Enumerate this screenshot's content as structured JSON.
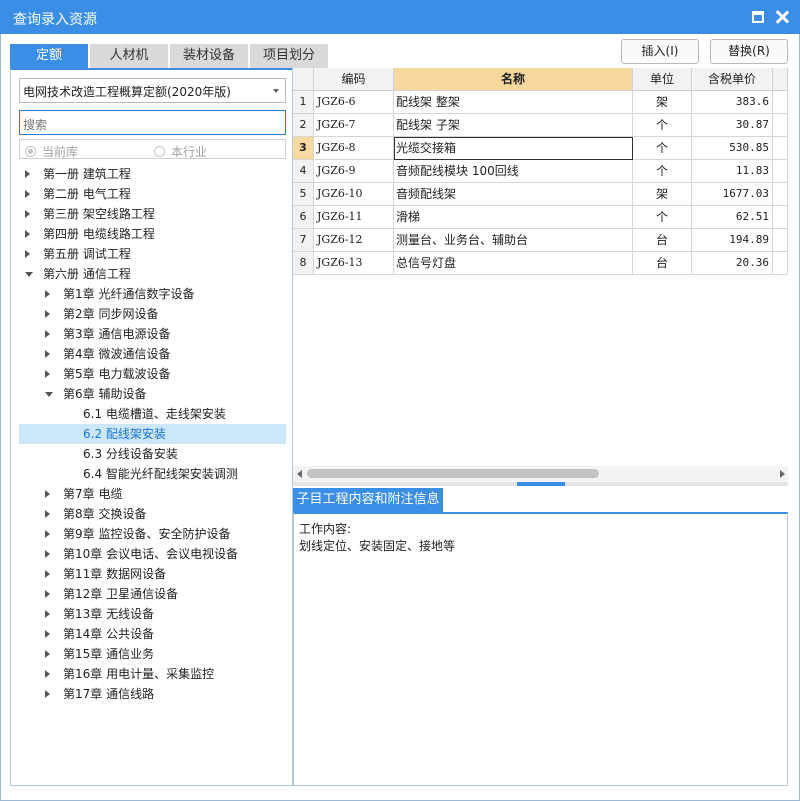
{
  "window": {
    "title": "查询录入资源"
  },
  "tabs": [
    "定额",
    "人材机",
    "装材设备",
    "项目划分"
  ],
  "header_buttons": {
    "insert": "插入(I)",
    "replace": "替换(R)"
  },
  "left": {
    "quota_library": "电网技术改造工程概算定额(2020年版)",
    "search_placeholder": "搜索",
    "scope_options": {
      "current_library": "当前库",
      "industry": "本行业"
    },
    "tree": [
      {
        "label": "第一册 建筑工程",
        "level": 0,
        "state": "collapsed"
      },
      {
        "label": "第二册 电气工程",
        "level": 0,
        "state": "collapsed"
      },
      {
        "label": "第三册 架空线路工程",
        "level": 0,
        "state": "collapsed"
      },
      {
        "label": "第四册 电缆线路工程",
        "level": 0,
        "state": "collapsed"
      },
      {
        "label": "第五册 调试工程",
        "level": 0,
        "state": "collapsed"
      },
      {
        "label": "第六册 通信工程",
        "level": 0,
        "state": "expanded"
      },
      {
        "label": "第1章 光纤通信数字设备",
        "level": 1,
        "state": "collapsed"
      },
      {
        "label": "第2章 同步网设备",
        "level": 1,
        "state": "collapsed"
      },
      {
        "label": "第3章 通信电源设备",
        "level": 1,
        "state": "collapsed"
      },
      {
        "label": "第4章 微波通信设备",
        "level": 1,
        "state": "collapsed"
      },
      {
        "label": "第5章 电力载波设备",
        "level": 1,
        "state": "collapsed"
      },
      {
        "label": "第6章 辅助设备",
        "level": 1,
        "state": "expanded"
      },
      {
        "label": "6.1 电缆槽道、走线架安装",
        "level": 2,
        "state": "leaf"
      },
      {
        "label": "6.2 配线架安装",
        "level": 2,
        "state": "leaf",
        "selected": true
      },
      {
        "label": "6.3 分线设备安装",
        "level": 2,
        "state": "leaf"
      },
      {
        "label": "6.4 智能光纤配线架安装调测",
        "level": 2,
        "state": "leaf"
      },
      {
        "label": "第7章 电缆",
        "level": 1,
        "state": "collapsed"
      },
      {
        "label": "第8章 交换设备",
        "level": 1,
        "state": "collapsed"
      },
      {
        "label": "第9章 监控设备、安全防护设备",
        "level": 1,
        "state": "collapsed"
      },
      {
        "label": "第10章 会议电话、会议电视设备",
        "level": 1,
        "state": "collapsed"
      },
      {
        "label": "第11章 数据网设备",
        "level": 1,
        "state": "collapsed"
      },
      {
        "label": "第12章 卫星通信设备",
        "level": 1,
        "state": "collapsed"
      },
      {
        "label": "第13章 无线设备",
        "level": 1,
        "state": "collapsed"
      },
      {
        "label": "第14章 公共设备",
        "level": 1,
        "state": "collapsed"
      },
      {
        "label": "第15章 通信业务",
        "level": 1,
        "state": "collapsed"
      },
      {
        "label": "第16章 用电计量、采集监控",
        "level": 1,
        "state": "collapsed"
      },
      {
        "label": "第17章 通信线路",
        "level": 1,
        "state": "collapsed"
      }
    ]
  },
  "table": {
    "columns": [
      "编码",
      "名称",
      "单位",
      "含税单价"
    ],
    "current_row": 3,
    "rows": [
      {
        "no": "1",
        "code": "JGZ6-6",
        "name": "配线架 整架",
        "unit": "架",
        "price": "383.6"
      },
      {
        "no": "2",
        "code": "JGZ6-7",
        "name": "配线架 子架",
        "unit": "个",
        "price": "30.87"
      },
      {
        "no": "3",
        "code": "JGZ6-8",
        "name": "光缆交接箱",
        "unit": "个",
        "price": "530.85"
      },
      {
        "no": "4",
        "code": "JGZ6-9",
        "name": "音频配线模块 100回线",
        "unit": "个",
        "price": "11.83"
      },
      {
        "no": "5",
        "code": "JGZ6-10",
        "name": "音频配线架",
        "unit": "架",
        "price": "1677.03"
      },
      {
        "no": "6",
        "code": "JGZ6-11",
        "name": "滑梯",
        "unit": "个",
        "price": "62.51"
      },
      {
        "no": "7",
        "code": "JGZ6-12",
        "name": "测量台、业务台、辅助台",
        "unit": "台",
        "price": "194.89"
      },
      {
        "no": "8",
        "code": "JGZ6-13",
        "name": "总信号灯盘",
        "unit": "台",
        "price": "20.36"
      }
    ]
  },
  "detail": {
    "tab_label": "子目工程内容和附注信息",
    "work_content_label": "工作内容:",
    "work_content": "划线定位、安装固定、接地等"
  },
  "colors": {
    "accent": "#3a8ee6",
    "selection": "#cce6fa",
    "current_cell": "#f7d89e"
  }
}
